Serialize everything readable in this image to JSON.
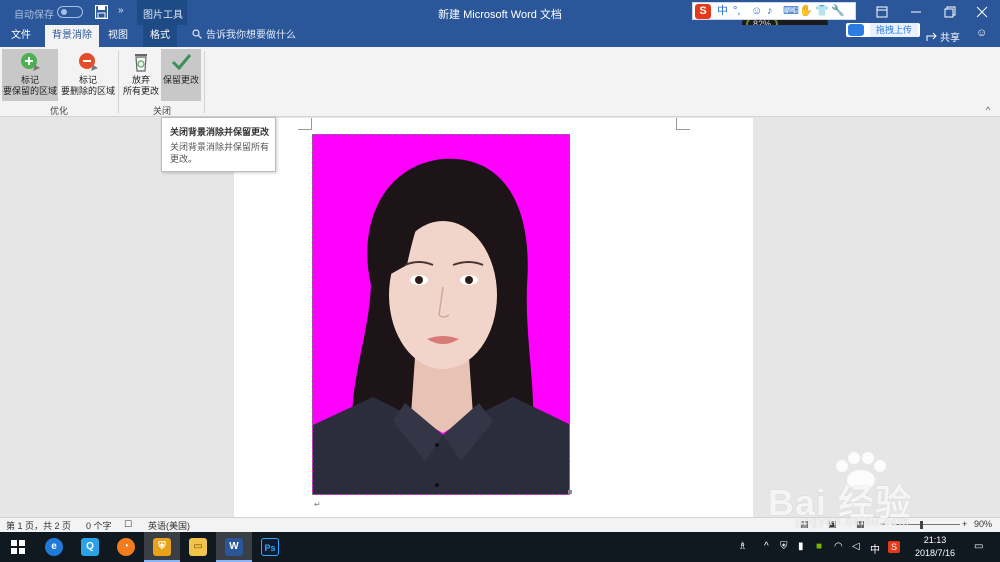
{
  "titlebar": {
    "autosave_label": "自动保存",
    "more_label": "»",
    "contextual_group": "图片工具",
    "document_title": "新建 Microsoft Word 文档",
    "window_buttons": [
      "ribbon-display-options",
      "minimize",
      "restore",
      "close"
    ]
  },
  "ime": {
    "logo": "S",
    "mode": "中",
    "punct": "°,",
    "speed_percent": "82%"
  },
  "tabs": [
    {
      "label": "文件",
      "active": false
    },
    {
      "label": "背景消除",
      "active": true
    },
    {
      "label": "视图",
      "active": false
    },
    {
      "label": "格式",
      "active": false
    }
  ],
  "tell_me": "告诉我你想要做什么",
  "cloud_upload": "拖拽上传",
  "share": "共享",
  "ribbon": {
    "buttons": [
      {
        "label1": "标记",
        "label2": "要保留的区域",
        "icon": "plus-circle-icon"
      },
      {
        "label1": "标记",
        "label2": "要删除的区域",
        "icon": "minus-circle-icon"
      },
      {
        "label1": "放弃",
        "label2": "所有更改",
        "icon": "recycle-bin-icon"
      },
      {
        "label1": "保留更改",
        "label2": "",
        "icon": "checkmark-icon"
      }
    ],
    "groups": [
      {
        "label": "优化"
      },
      {
        "label": "关闭"
      }
    ]
  },
  "tooltip": {
    "title": "关闭背景消除并保留更改",
    "description": "关闭背景消除并保留所有更改。"
  },
  "document": {
    "photo_background": "#ff00ff",
    "paragraph_mark": "↵"
  },
  "statusbar": {
    "page_info": "第 1 页，共 2 页",
    "word_count": "0 个字",
    "language": "英语(美国)",
    "zoom": "90%"
  },
  "watermark": {
    "text": "Bai 经验",
    "sub": "jingyan.baidu.com"
  },
  "taskbar": {
    "apps": [
      {
        "name": "start",
        "glyph": "⊞"
      },
      {
        "name": "ie",
        "glyph": "e"
      },
      {
        "name": "qq",
        "glyph": "Q"
      },
      {
        "name": "browser",
        "glyph": "◔"
      },
      {
        "name": "security",
        "glyph": "⛨"
      },
      {
        "name": "explorer",
        "glyph": "▭"
      },
      {
        "name": "word",
        "glyph": "W"
      },
      {
        "name": "photoshop",
        "glyph": "Ps"
      }
    ],
    "tray_lang": "中",
    "time": "21:13",
    "date": "2018/7/16"
  },
  "colors": {
    "word_blue": "#2b579a",
    "ribbon_bg": "#f3f3f3",
    "magenta": "#ff00ff",
    "taskbar": "#101820"
  }
}
